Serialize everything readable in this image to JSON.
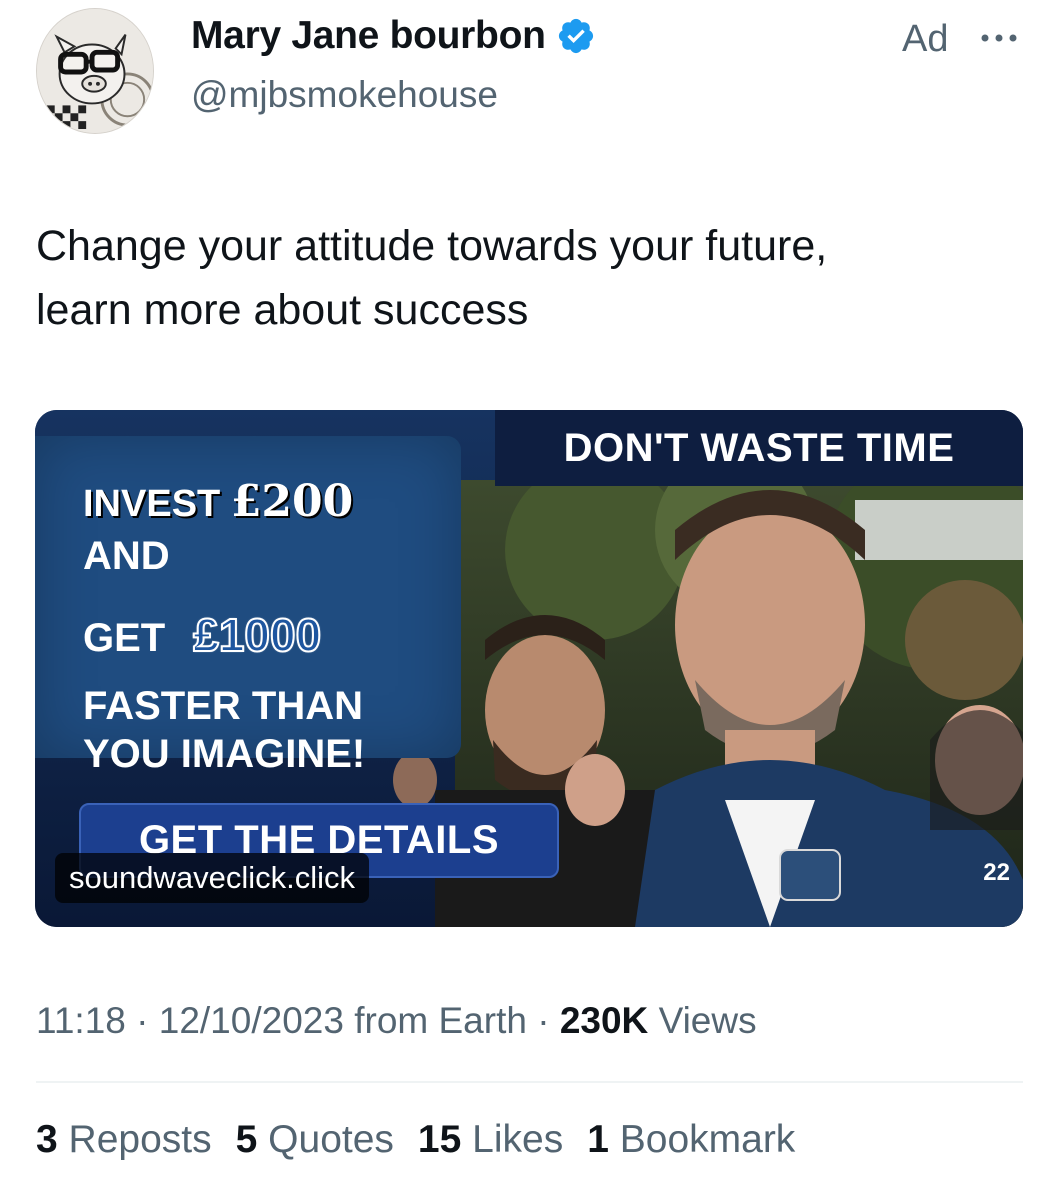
{
  "author": {
    "display_name": "Mary Jane bourbon",
    "handle": "@mjbsmokehouse",
    "verified_color": "#1d9bf0"
  },
  "ad_label": "Ad",
  "tweet": {
    "text_lines": [
      "Change your attitude towards your future,",
      "learn more about success"
    ]
  },
  "media": {
    "headline": {
      "invest": "INVEST",
      "invest_amount": "£200",
      "and": "AND",
      "get": "GET",
      "get_amount": "£1000",
      "line3": "FASTER THAN",
      "line4": "YOU IMAGINE!"
    },
    "banner": "DON'T WASTE TIME",
    "cta": "GET THE DETAILS",
    "domain": "soundwaveclick.click",
    "jacket_number": "22"
  },
  "meta": {
    "time": "11:18",
    "date": "12/10/2023",
    "source": "from Earth",
    "views_count": "230K",
    "views_label": "Views"
  },
  "stats": {
    "reposts_count": "3",
    "reposts_label": "Reposts",
    "quotes_count": "5",
    "quotes_label": "Quotes",
    "likes_count": "15",
    "likes_label": "Likes",
    "bookmarks_count": "1",
    "bookmarks_label": "Bookmark"
  },
  "colors": {
    "text_primary": "#0f1419",
    "text_secondary": "#536471",
    "verified_blue": "#1d9bf0",
    "ad_navy": "#0e1e40",
    "ad_blue": "#1f4c80"
  },
  "icons": [
    "verified-badge-icon",
    "more-options-icon"
  ]
}
